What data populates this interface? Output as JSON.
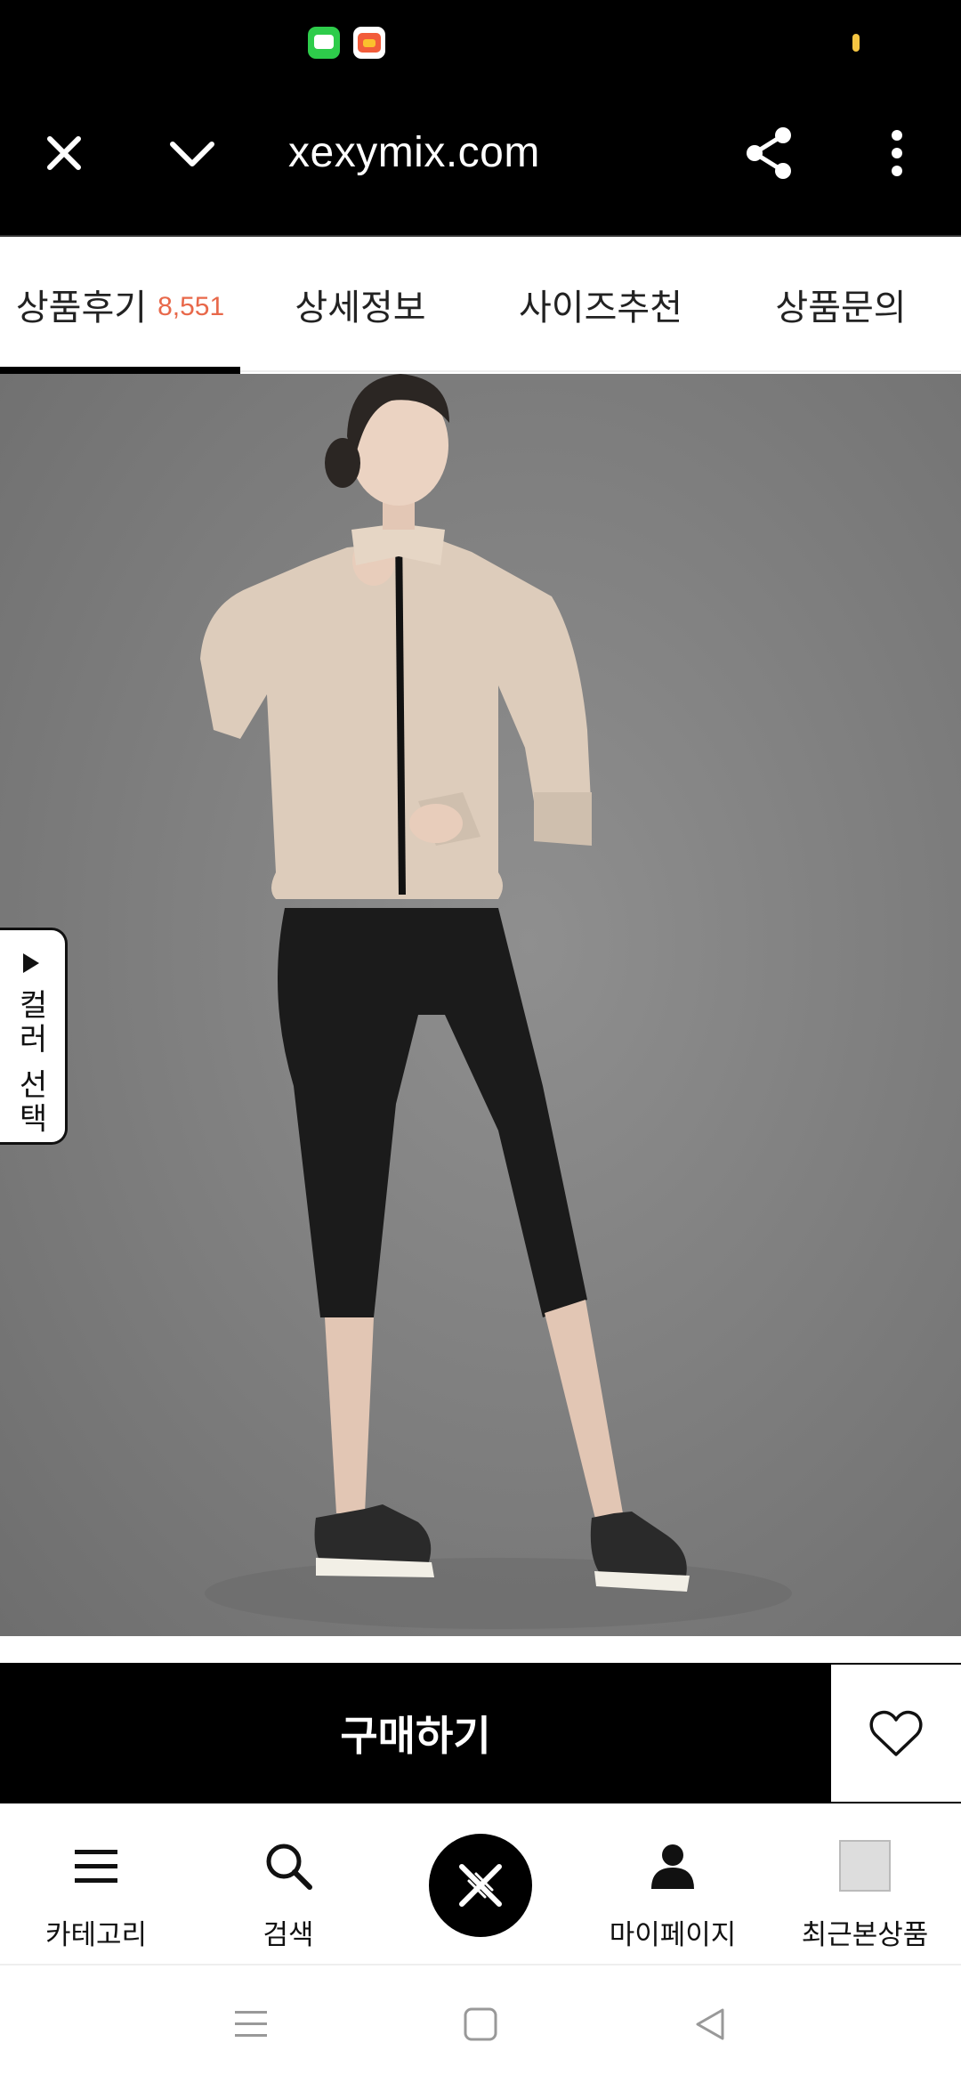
{
  "browser": {
    "url": "xexymix.com"
  },
  "tabs": [
    {
      "label": "상품후기",
      "count": "8,551",
      "active": true
    },
    {
      "label": "상세정보"
    },
    {
      "label": "사이즈추천"
    },
    {
      "label": "상품문의"
    }
  ],
  "product": {
    "color_select_label": "컬러 선택"
  },
  "purchase": {
    "buy_label": "구매하기"
  },
  "bottom_nav": [
    {
      "label": "카테고리",
      "icon": "menu-icon"
    },
    {
      "label": "검색",
      "icon": "search-icon"
    },
    {
      "label": "",
      "icon": "xexymix-logo-icon"
    },
    {
      "label": "마이페이지",
      "icon": "person-icon"
    },
    {
      "label": "최근본상품",
      "icon": "recent-product-thumbnail"
    }
  ],
  "colors": {
    "accent_count": "#e8684a",
    "chat_button": "#f7a81d",
    "purchase_bar": "#000000"
  }
}
